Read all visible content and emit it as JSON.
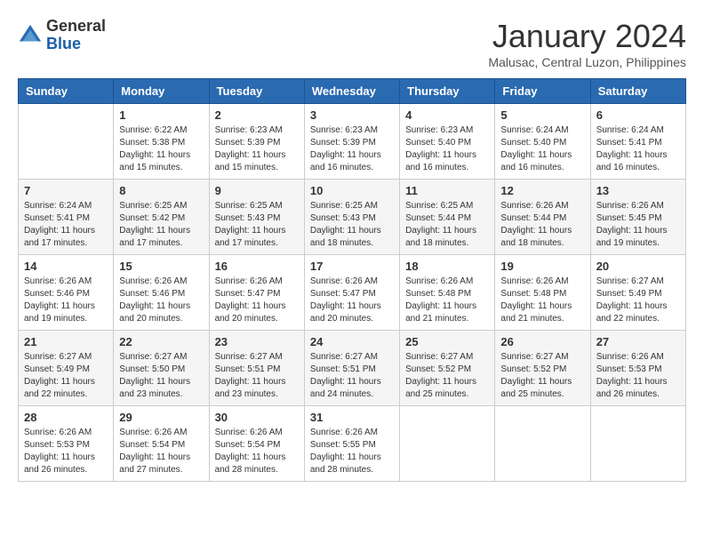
{
  "header": {
    "logo_line1": "General",
    "logo_line2": "Blue",
    "month_title": "January 2024",
    "subtitle": "Malusac, Central Luzon, Philippines"
  },
  "weekdays": [
    "Sunday",
    "Monday",
    "Tuesday",
    "Wednesday",
    "Thursday",
    "Friday",
    "Saturday"
  ],
  "weeks": [
    [
      {
        "day": "",
        "sunrise": "",
        "sunset": "",
        "daylight": ""
      },
      {
        "day": "1",
        "sunrise": "Sunrise: 6:22 AM",
        "sunset": "Sunset: 5:38 PM",
        "daylight": "Daylight: 11 hours and 15 minutes."
      },
      {
        "day": "2",
        "sunrise": "Sunrise: 6:23 AM",
        "sunset": "Sunset: 5:39 PM",
        "daylight": "Daylight: 11 hours and 15 minutes."
      },
      {
        "day": "3",
        "sunrise": "Sunrise: 6:23 AM",
        "sunset": "Sunset: 5:39 PM",
        "daylight": "Daylight: 11 hours and 16 minutes."
      },
      {
        "day": "4",
        "sunrise": "Sunrise: 6:23 AM",
        "sunset": "Sunset: 5:40 PM",
        "daylight": "Daylight: 11 hours and 16 minutes."
      },
      {
        "day": "5",
        "sunrise": "Sunrise: 6:24 AM",
        "sunset": "Sunset: 5:40 PM",
        "daylight": "Daylight: 11 hours and 16 minutes."
      },
      {
        "day": "6",
        "sunrise": "Sunrise: 6:24 AM",
        "sunset": "Sunset: 5:41 PM",
        "daylight": "Daylight: 11 hours and 16 minutes."
      }
    ],
    [
      {
        "day": "7",
        "sunrise": "Sunrise: 6:24 AM",
        "sunset": "Sunset: 5:41 PM",
        "daylight": "Daylight: 11 hours and 17 minutes."
      },
      {
        "day": "8",
        "sunrise": "Sunrise: 6:25 AM",
        "sunset": "Sunset: 5:42 PM",
        "daylight": "Daylight: 11 hours and 17 minutes."
      },
      {
        "day": "9",
        "sunrise": "Sunrise: 6:25 AM",
        "sunset": "Sunset: 5:43 PM",
        "daylight": "Daylight: 11 hours and 17 minutes."
      },
      {
        "day": "10",
        "sunrise": "Sunrise: 6:25 AM",
        "sunset": "Sunset: 5:43 PM",
        "daylight": "Daylight: 11 hours and 18 minutes."
      },
      {
        "day": "11",
        "sunrise": "Sunrise: 6:25 AM",
        "sunset": "Sunset: 5:44 PM",
        "daylight": "Daylight: 11 hours and 18 minutes."
      },
      {
        "day": "12",
        "sunrise": "Sunrise: 6:26 AM",
        "sunset": "Sunset: 5:44 PM",
        "daylight": "Daylight: 11 hours and 18 minutes."
      },
      {
        "day": "13",
        "sunrise": "Sunrise: 6:26 AM",
        "sunset": "Sunset: 5:45 PM",
        "daylight": "Daylight: 11 hours and 19 minutes."
      }
    ],
    [
      {
        "day": "14",
        "sunrise": "Sunrise: 6:26 AM",
        "sunset": "Sunset: 5:46 PM",
        "daylight": "Daylight: 11 hours and 19 minutes."
      },
      {
        "day": "15",
        "sunrise": "Sunrise: 6:26 AM",
        "sunset": "Sunset: 5:46 PM",
        "daylight": "Daylight: 11 hours and 20 minutes."
      },
      {
        "day": "16",
        "sunrise": "Sunrise: 6:26 AM",
        "sunset": "Sunset: 5:47 PM",
        "daylight": "Daylight: 11 hours and 20 minutes."
      },
      {
        "day": "17",
        "sunrise": "Sunrise: 6:26 AM",
        "sunset": "Sunset: 5:47 PM",
        "daylight": "Daylight: 11 hours and 20 minutes."
      },
      {
        "day": "18",
        "sunrise": "Sunrise: 6:26 AM",
        "sunset": "Sunset: 5:48 PM",
        "daylight": "Daylight: 11 hours and 21 minutes."
      },
      {
        "day": "19",
        "sunrise": "Sunrise: 6:26 AM",
        "sunset": "Sunset: 5:48 PM",
        "daylight": "Daylight: 11 hours and 21 minutes."
      },
      {
        "day": "20",
        "sunrise": "Sunrise: 6:27 AM",
        "sunset": "Sunset: 5:49 PM",
        "daylight": "Daylight: 11 hours and 22 minutes."
      }
    ],
    [
      {
        "day": "21",
        "sunrise": "Sunrise: 6:27 AM",
        "sunset": "Sunset: 5:49 PM",
        "daylight": "Daylight: 11 hours and 22 minutes."
      },
      {
        "day": "22",
        "sunrise": "Sunrise: 6:27 AM",
        "sunset": "Sunset: 5:50 PM",
        "daylight": "Daylight: 11 hours and 23 minutes."
      },
      {
        "day": "23",
        "sunrise": "Sunrise: 6:27 AM",
        "sunset": "Sunset: 5:51 PM",
        "daylight": "Daylight: 11 hours and 23 minutes."
      },
      {
        "day": "24",
        "sunrise": "Sunrise: 6:27 AM",
        "sunset": "Sunset: 5:51 PM",
        "daylight": "Daylight: 11 hours and 24 minutes."
      },
      {
        "day": "25",
        "sunrise": "Sunrise: 6:27 AM",
        "sunset": "Sunset: 5:52 PM",
        "daylight": "Daylight: 11 hours and 25 minutes."
      },
      {
        "day": "26",
        "sunrise": "Sunrise: 6:27 AM",
        "sunset": "Sunset: 5:52 PM",
        "daylight": "Daylight: 11 hours and 25 minutes."
      },
      {
        "day": "27",
        "sunrise": "Sunrise: 6:26 AM",
        "sunset": "Sunset: 5:53 PM",
        "daylight": "Daylight: 11 hours and 26 minutes."
      }
    ],
    [
      {
        "day": "28",
        "sunrise": "Sunrise: 6:26 AM",
        "sunset": "Sunset: 5:53 PM",
        "daylight": "Daylight: 11 hours and 26 minutes."
      },
      {
        "day": "29",
        "sunrise": "Sunrise: 6:26 AM",
        "sunset": "Sunset: 5:54 PM",
        "daylight": "Daylight: 11 hours and 27 minutes."
      },
      {
        "day": "30",
        "sunrise": "Sunrise: 6:26 AM",
        "sunset": "Sunset: 5:54 PM",
        "daylight": "Daylight: 11 hours and 28 minutes."
      },
      {
        "day": "31",
        "sunrise": "Sunrise: 6:26 AM",
        "sunset": "Sunset: 5:55 PM",
        "daylight": "Daylight: 11 hours and 28 minutes."
      },
      {
        "day": "",
        "sunrise": "",
        "sunset": "",
        "daylight": ""
      },
      {
        "day": "",
        "sunrise": "",
        "sunset": "",
        "daylight": ""
      },
      {
        "day": "",
        "sunrise": "",
        "sunset": "",
        "daylight": ""
      }
    ]
  ]
}
